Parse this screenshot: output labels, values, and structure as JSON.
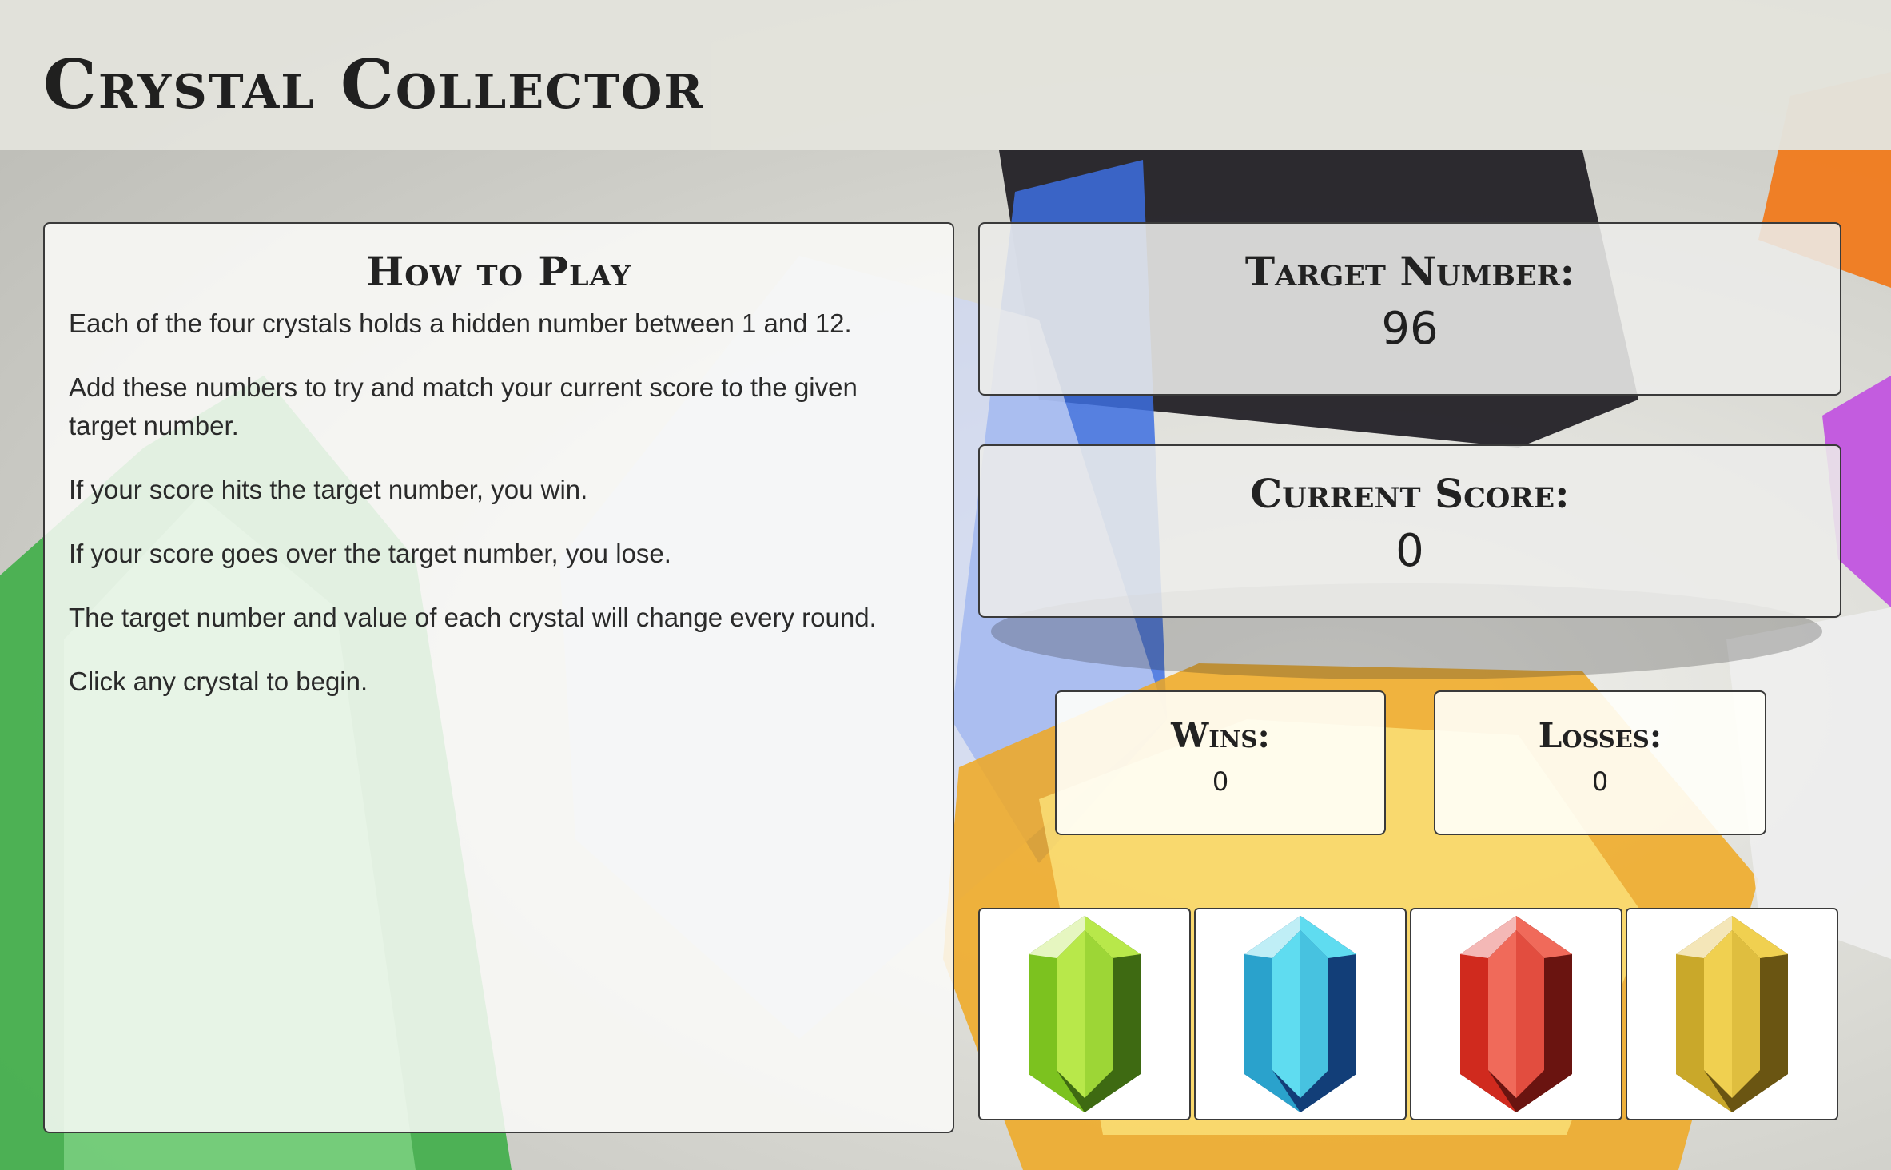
{
  "header": {
    "title": "Crystal Collector"
  },
  "how_to_play": {
    "heading": "How to Play",
    "paragraphs": [
      "Each of the four crystals holds a hidden number between 1 and 12.",
      "Add these numbers to try and match your current score to the given target number.",
      "If your score hits the target number, you win.",
      "If your score goes over the target number, you lose.",
      "The target number and value of each crystal will change every round.",
      "Click any crystal to begin."
    ]
  },
  "target": {
    "label": "Target Number:",
    "value": "96"
  },
  "score": {
    "label": "Current Score:",
    "value": "0"
  },
  "wins": {
    "label": "Wins:",
    "value": "0"
  },
  "losses": {
    "label": "Losses:",
    "value": "0"
  },
  "crystals": [
    {
      "name": "green",
      "light": "#b8e84a",
      "mid": "#7cc21f",
      "dark": "#3e6a12",
      "edge": "#e6f6c0"
    },
    {
      "name": "blue",
      "light": "#5fdcf0",
      "mid": "#2aa2cc",
      "dark": "#123e78",
      "edge": "#bfeef6"
    },
    {
      "name": "red",
      "light": "#f06a5a",
      "mid": "#d02a1e",
      "dark": "#6a1410",
      "edge": "#f4b8b6"
    },
    {
      "name": "gold",
      "light": "#f0d050",
      "mid": "#c9a82a",
      "dark": "#6a5512",
      "edge": "#f4e6b8"
    }
  ]
}
